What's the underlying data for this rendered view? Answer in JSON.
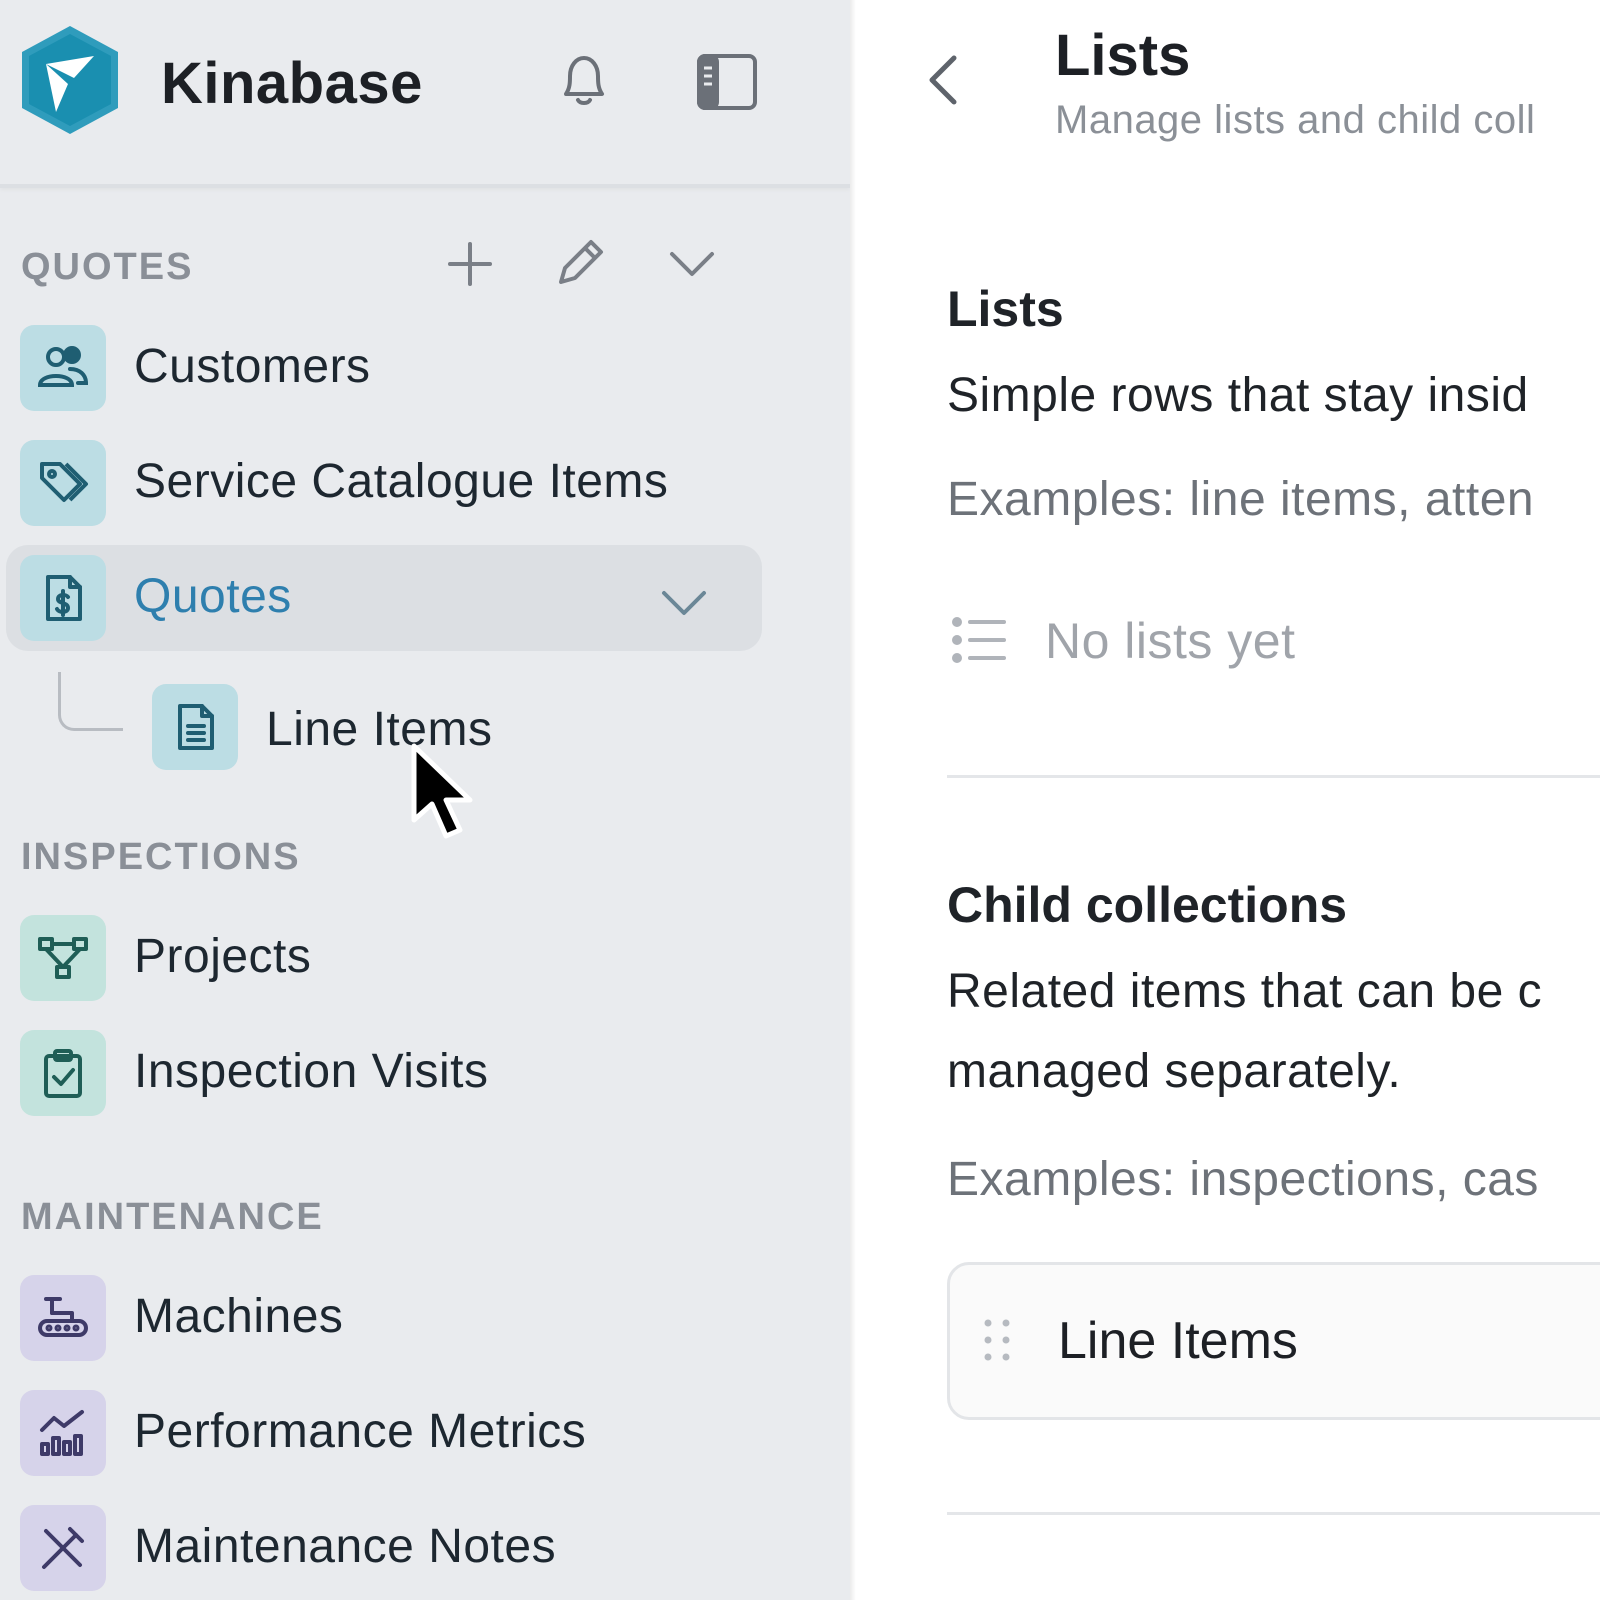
{
  "app": {
    "name": "Kinabase",
    "logo_color": "#1a8fb0"
  },
  "page": {
    "title": "Lists",
    "subtitle": "Manage lists and child coll"
  },
  "sidebar": {
    "sections": [
      {
        "label": "QUOTES",
        "items": [
          {
            "label": "Customers",
            "icon": "users-icon"
          },
          {
            "label": "Service Catalogue Items",
            "icon": "tags-icon"
          },
          {
            "label": "Quotes",
            "icon": "invoice-icon",
            "active": true,
            "expanded": true,
            "children": [
              {
                "label": "Line Items",
                "icon": "document-icon"
              }
            ]
          }
        ]
      },
      {
        "label": "INSPECTIONS",
        "items": [
          {
            "label": "Projects",
            "icon": "flow-icon"
          },
          {
            "label": "Inspection Visits",
            "icon": "clipboard-check-icon"
          }
        ]
      },
      {
        "label": "MAINTENANCE",
        "items": [
          {
            "label": "Machines",
            "icon": "conveyor-icon"
          },
          {
            "label": "Performance Metrics",
            "icon": "chart-icon"
          },
          {
            "label": "Maintenance Notes",
            "icon": "tools-icon"
          }
        ]
      }
    ]
  },
  "lists_section": {
    "title": "Lists",
    "description": "Simple rows that stay insid",
    "examples": "Examples: line items, atten",
    "empty_text": "No lists yet"
  },
  "child_section": {
    "title": "Child collections",
    "description_line1": "Related items that can be c",
    "description_line2": "managed separately.",
    "examples": "Examples: inspections, cas",
    "rows": [
      {
        "label": "Line Items"
      }
    ]
  },
  "colors": {
    "active_text": "#2e7fae",
    "sidebar_bg": "#e9ebee",
    "teal_tile": "#bcdde4",
    "mint_tile": "#c3e3dd",
    "lavender_tile": "#d6d3ea"
  }
}
